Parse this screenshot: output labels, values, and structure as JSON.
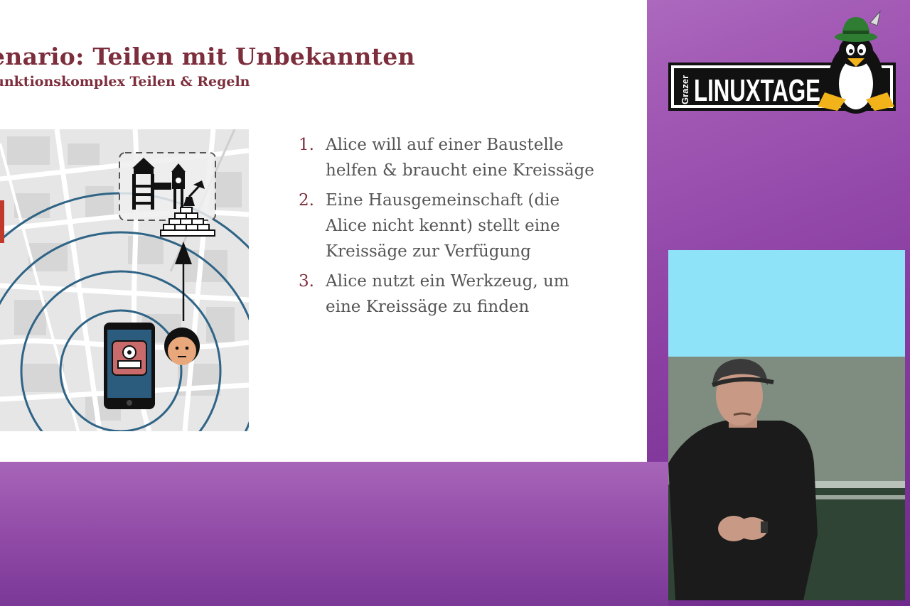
{
  "slide": {
    "title": "enario: Teilen mit Unbekannten",
    "subtitle": "unktionskomplex Teilen & Regeln",
    "steps": [
      {
        "num": "1.",
        "lines": [
          "Alice will auf einer Baustelle",
          "helfen & braucht eine Kreissäge"
        ]
      },
      {
        "num": "2.",
        "lines": [
          "Eine Hausgemeinschaft (die",
          "Alice nicht kennt) stellt eine",
          "Kreissäge zur Verfügung"
        ]
      },
      {
        "num": "3.",
        "lines": [
          "Alice nutzt ein Werkzeug, um",
          "eine Kreissäge zu finden"
        ]
      }
    ],
    "colors": {
      "accent": "#7d2e3c",
      "body_text": "#555555",
      "ring": "#2f6486",
      "phone": "#2b5b7d"
    }
  },
  "logo": {
    "prefix": "Grazer",
    "text": "LINUXTAGE",
    "icon": "tux-penguin-with-hat-icon"
  },
  "video": {
    "description_icon": "speaker-video-feed"
  }
}
